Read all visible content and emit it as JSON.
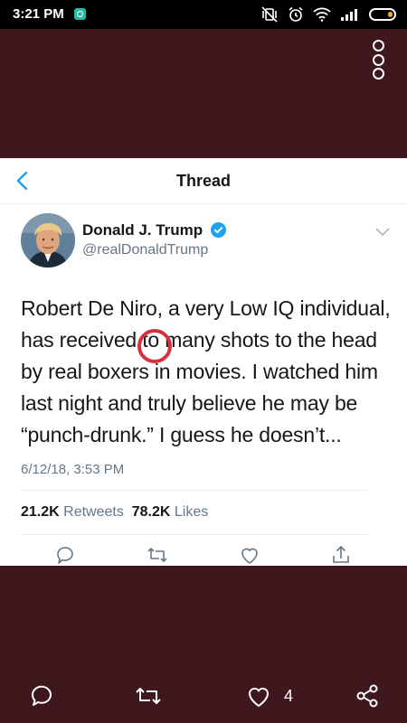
{
  "status_bar": {
    "time": "3:21 PM"
  },
  "header": {
    "title": "Thread"
  },
  "tweet": {
    "name": "Donald J. Trump",
    "handle": "@realDonaldTrump",
    "text_part1": "Robert De Niro, a very Low IQ individual, has received ",
    "highlight": "to",
    "text_part2": " many shots to the head by real boxers in movies. I watched him last night and truly believe he may be “punch-drunk.” I guess he doesn’t...",
    "timestamp": "6/12/18, 3:53 PM",
    "retweets_count": "21.2K",
    "retweets_label": "Retweets",
    "likes_count": "78.2K",
    "likes_label": "Likes"
  },
  "bottom_bar": {
    "like_count": "4"
  },
  "colors": {
    "background": "#3f181d",
    "twitter_blue": "#1da1f2",
    "highlight_circle": "#d7313d",
    "battery": "#f5a623"
  }
}
